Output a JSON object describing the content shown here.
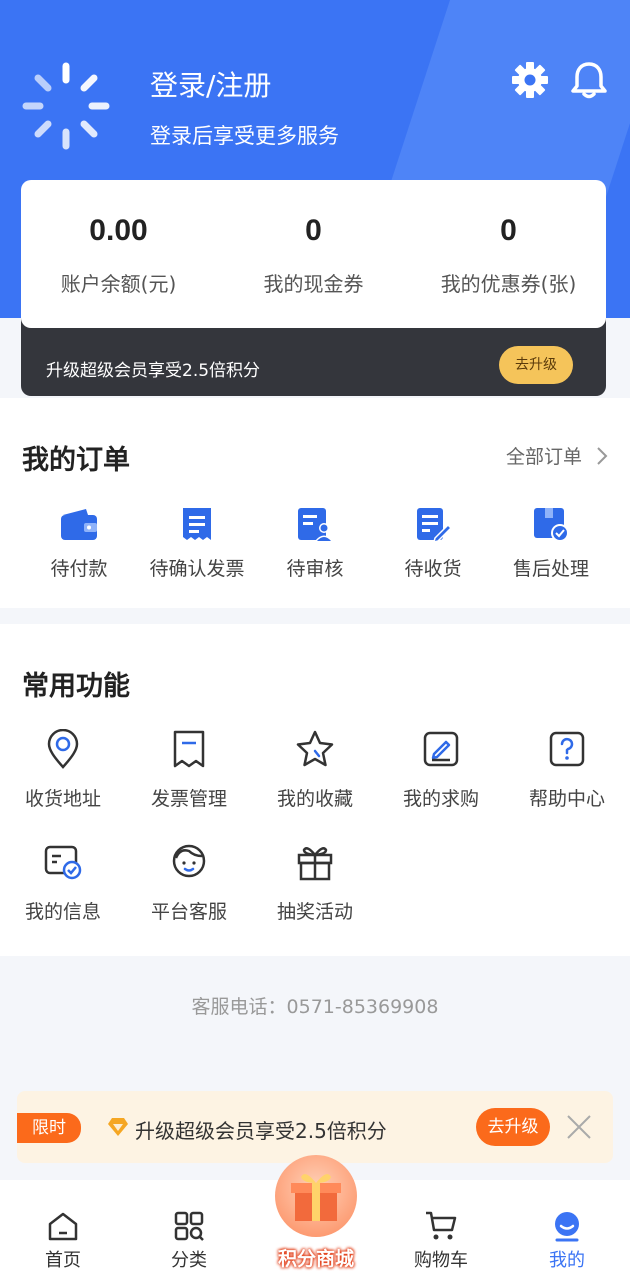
{
  "header": {
    "title": "登录/注册",
    "subtitle": "登录后享受更多服务",
    "avatar_icon": "loading-spinner-icon",
    "settings_icon": "gear-icon",
    "notification_icon": "bell-icon",
    "bg_color": "#3b74f4"
  },
  "stats": [
    {
      "value": "0.00",
      "label": "账户余额(元)"
    },
    {
      "value": "0",
      "label": "我的现金券"
    },
    {
      "value": "0",
      "label": "我的优惠券(张)"
    }
  ],
  "vip": {
    "text": "升级超级会员享受2.5倍积分",
    "button": "去升级"
  },
  "orders": {
    "title": "我的订单",
    "all_link": "全部订单",
    "items": [
      {
        "label": "待付款",
        "icon": "wallet-icon"
      },
      {
        "label": "待确认发票",
        "icon": "receipt-icon"
      },
      {
        "label": "待审核",
        "icon": "review-icon"
      },
      {
        "label": "待收货",
        "icon": "edit-document-icon"
      },
      {
        "label": "售后处理",
        "icon": "package-check-icon"
      }
    ]
  },
  "functions": {
    "title": "常用功能",
    "items": [
      {
        "label": "收货地址",
        "icon": "location-pin-icon"
      },
      {
        "label": "发票管理",
        "icon": "invoice-icon"
      },
      {
        "label": "我的收藏",
        "icon": "star-icon"
      },
      {
        "label": "我的求购",
        "icon": "pencil-box-icon"
      },
      {
        "label": "帮助中心",
        "icon": "question-icon"
      },
      {
        "label": "我的信息",
        "icon": "id-card-icon"
      },
      {
        "label": "平台客服",
        "icon": "customer-service-icon"
      },
      {
        "label": "抽奖活动",
        "icon": "gift-icon"
      }
    ]
  },
  "hotline": "客服电话：0571-85369908",
  "promo": {
    "tag": "限时",
    "text": "升级超级会员享受2.5倍积分",
    "button": "去升级"
  },
  "tabbar": [
    {
      "label": "首页",
      "icon": "home-icon",
      "active": false
    },
    {
      "label": "分类",
      "icon": "grid-icon",
      "active": false
    },
    {
      "label": "积分商城",
      "icon": "gift-box-icon",
      "active": false
    },
    {
      "label": "购物车",
      "icon": "cart-icon",
      "active": false
    },
    {
      "label": "我的",
      "icon": "profile-icon",
      "active": true
    }
  ],
  "colors": {
    "accent": "#3b74f4",
    "orange": "#fb6a1b",
    "vip_gold": "#f5c45a"
  }
}
